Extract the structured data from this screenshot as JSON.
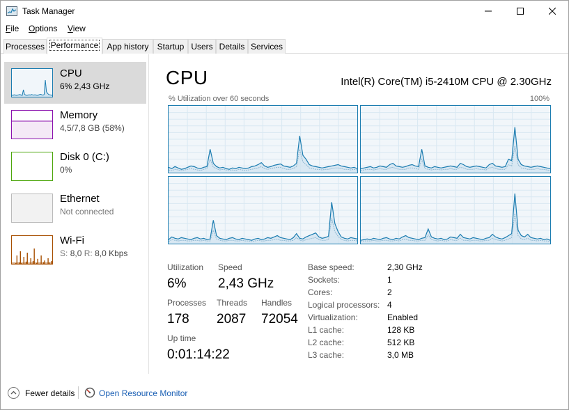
{
  "window": {
    "title": "Task Manager"
  },
  "menu": [
    {
      "label": "File",
      "mnemonic": "F",
      "rest": "ile"
    },
    {
      "label": "Options",
      "mnemonic": "O",
      "rest": "ptions"
    },
    {
      "label": "View",
      "mnemonic": "V",
      "rest": "iew"
    }
  ],
  "tabs": [
    "Processes",
    "Performance",
    "App history",
    "Startup",
    "Users",
    "Details",
    "Services"
  ],
  "active_tab": "Performance",
  "sidebar": [
    {
      "name": "CPU",
      "sub": "6% 2,43 GHz",
      "selected": true,
      "color": "#1b7cb0"
    },
    {
      "name": "Memory",
      "sub": "4,5/7,8 GB (58%)",
      "selected": false,
      "color": "#8b12ae"
    },
    {
      "name": "Disk 0 (C:)",
      "sub": "0%",
      "selected": false,
      "color": "#4da60c"
    },
    {
      "name": "Ethernet",
      "sub": "Not connected",
      "selected": false,
      "color": "#999999"
    },
    {
      "name": "Wi-Fi",
      "sub_s_label": "S:",
      "sub_s": "8,0",
      "sub_r_label": "R:",
      "sub_r": "8,0 Kbps",
      "selected": false,
      "color": "#a74f01"
    }
  ],
  "main": {
    "title": "CPU",
    "model": "Intel(R) Core(TM) i5-2410M CPU @ 2.30GHz",
    "graph_caption": "% Utilization over 60 seconds",
    "graph_max": "100%",
    "accent": "#1b7cb0"
  },
  "stats": {
    "utilization_label": "Utilization",
    "utilization": "6%",
    "speed_label": "Speed",
    "speed": "2,43 GHz",
    "processes_label": "Processes",
    "processes": "178",
    "threads_label": "Threads",
    "threads": "2087",
    "handles_label": "Handles",
    "handles": "72054",
    "uptime_label": "Up time",
    "uptime": "0:01:14:22"
  },
  "info": [
    {
      "label": "Base speed:",
      "value": "2,30 GHz"
    },
    {
      "label": "Sockets:",
      "value": "1"
    },
    {
      "label": "Cores:",
      "value": "2"
    },
    {
      "label": "Logical processors:",
      "value": "4"
    },
    {
      "label": "Virtualization:",
      "value": "Enabled"
    },
    {
      "label": "L1 cache:",
      "value": "128 KB"
    },
    {
      "label": "L2 cache:",
      "value": "512 KB"
    },
    {
      "label": "L3 cache:",
      "value": "3,0 MB"
    }
  ],
  "footer": {
    "fewer_details": "Fewer details",
    "open_monitor": "Open Resource Monitor"
  },
  "chart_data": [
    {
      "type": "area",
      "series": [
        {
          "values": [
            8,
            6,
            9,
            7,
            5,
            6,
            8,
            10,
            9,
            7,
            6,
            8,
            9,
            35,
            14,
            9,
            7,
            8,
            6,
            5,
            7,
            6,
            8,
            7,
            6,
            7,
            9,
            10,
            12,
            15,
            10,
            8,
            9,
            11,
            12,
            13,
            10,
            9,
            8,
            10,
            14,
            55,
            26,
            20,
            12,
            10,
            9,
            8,
            7,
            8,
            9,
            10,
            11,
            12,
            10,
            9,
            8,
            7,
            8,
            6
          ]
        },
        {
          "values": [
            4,
            3,
            5,
            4,
            3,
            4,
            5,
            6,
            5,
            4,
            3,
            5,
            6,
            20,
            8,
            6,
            4,
            5,
            4,
            3,
            4,
            3,
            5,
            4,
            3,
            4,
            5,
            6,
            7,
            9,
            6,
            5,
            6,
            7,
            8,
            8,
            6,
            5,
            5,
            6,
            9,
            35,
            16,
            12,
            7,
            6,
            5,
            5,
            4,
            5,
            5,
            6,
            7,
            7,
            6,
            5,
            5,
            4,
            5,
            4
          ]
        }
      ]
    },
    {
      "type": "area",
      "series": [
        {
          "values": [
            6,
            7,
            8,
            9,
            7,
            8,
            10,
            9,
            8,
            12,
            14,
            10,
            9,
            8,
            9,
            11,
            12,
            10,
            9,
            35,
            10,
            8,
            7,
            9,
            8,
            7,
            8,
            9,
            10,
            9,
            8,
            14,
            12,
            9,
            8,
            9,
            10,
            9,
            8,
            7,
            12,
            14,
            10,
            9,
            8,
            9,
            20,
            18,
            68,
            20,
            12,
            10,
            9,
            8,
            9,
            10,
            9,
            8,
            7,
            6
          ]
        },
        {
          "values": [
            3,
            4,
            5,
            5,
            4,
            5,
            6,
            5,
            5,
            7,
            8,
            6,
            5,
            5,
            5,
            7,
            7,
            6,
            5,
            20,
            6,
            5,
            4,
            5,
            5,
            4,
            5,
            5,
            6,
            5,
            5,
            8,
            7,
            5,
            5,
            5,
            6,
            5,
            5,
            4,
            7,
            8,
            6,
            5,
            5,
            5,
            12,
            10,
            40,
            12,
            7,
            6,
            5,
            5,
            5,
            6,
            5,
            5,
            4,
            3
          ]
        }
      ]
    },
    {
      "type": "area",
      "series": [
        {
          "values": [
            6,
            10,
            8,
            7,
            9,
            8,
            7,
            6,
            8,
            9,
            7,
            8,
            6,
            7,
            35,
            12,
            8,
            7,
            6,
            8,
            9,
            7,
            6,
            8,
            7,
            6,
            5,
            7,
            8,
            6,
            7,
            9,
            8,
            10,
            12,
            9,
            8,
            7,
            6,
            9,
            15,
            8,
            7,
            10,
            12,
            14,
            16,
            10,
            8,
            9,
            11,
            62,
            30,
            18,
            10,
            8,
            7,
            9,
            8,
            7
          ]
        },
        {
          "values": [
            3,
            6,
            5,
            4,
            5,
            5,
            4,
            4,
            5,
            5,
            4,
            5,
            4,
            4,
            20,
            7,
            5,
            4,
            4,
            5,
            5,
            4,
            4,
            5,
            4,
            4,
            3,
            4,
            5,
            4,
            4,
            5,
            5,
            6,
            7,
            5,
            5,
            4,
            4,
            5,
            9,
            5,
            4,
            6,
            7,
            8,
            9,
            6,
            5,
            5,
            6,
            38,
            18,
            11,
            6,
            5,
            4,
            5,
            5,
            4
          ]
        }
      ]
    },
    {
      "type": "area",
      "series": [
        {
          "values": [
            5,
            6,
            7,
            6,
            8,
            7,
            6,
            8,
            9,
            7,
            6,
            8,
            7,
            10,
            12,
            9,
            8,
            7,
            6,
            8,
            9,
            22,
            10,
            8,
            7,
            8,
            6,
            7,
            10,
            9,
            8,
            14,
            9,
            8,
            7,
            9,
            8,
            7,
            6,
            8,
            9,
            14,
            10,
            8,
            7,
            9,
            12,
            15,
            75,
            20,
            12,
            10,
            14,
            9,
            8,
            7,
            8,
            6,
            7,
            5
          ]
        },
        {
          "values": [
            3,
            4,
            4,
            4,
            5,
            4,
            4,
            5,
            5,
            4,
            4,
            5,
            4,
            6,
            7,
            5,
            5,
            4,
            4,
            5,
            5,
            13,
            6,
            5,
            4,
            5,
            4,
            4,
            6,
            5,
            5,
            8,
            5,
            5,
            4,
            5,
            5,
            4,
            4,
            5,
            5,
            8,
            6,
            5,
            4,
            5,
            7,
            9,
            45,
            12,
            7,
            6,
            8,
            5,
            5,
            4,
            5,
            4,
            4,
            3
          ]
        }
      ]
    }
  ],
  "thumb_data": {
    "cpu": [
      6,
      5,
      7,
      6,
      5,
      6,
      7,
      8,
      6,
      5,
      25,
      9,
      6,
      5,
      6,
      7,
      6,
      8,
      7,
      6,
      7,
      6,
      5,
      6,
      8,
      9,
      7,
      6,
      8,
      60,
      18,
      12,
      8,
      7,
      6,
      5
    ],
    "wifi": [
      0,
      0,
      0,
      3,
      30,
      0,
      5,
      45,
      2,
      0,
      25,
      0,
      8,
      40,
      0,
      0,
      20,
      0,
      10,
      55,
      0,
      4,
      18,
      0,
      0,
      30,
      0,
      6,
      12,
      0,
      0,
      20,
      5,
      0,
      10,
      0
    ]
  }
}
